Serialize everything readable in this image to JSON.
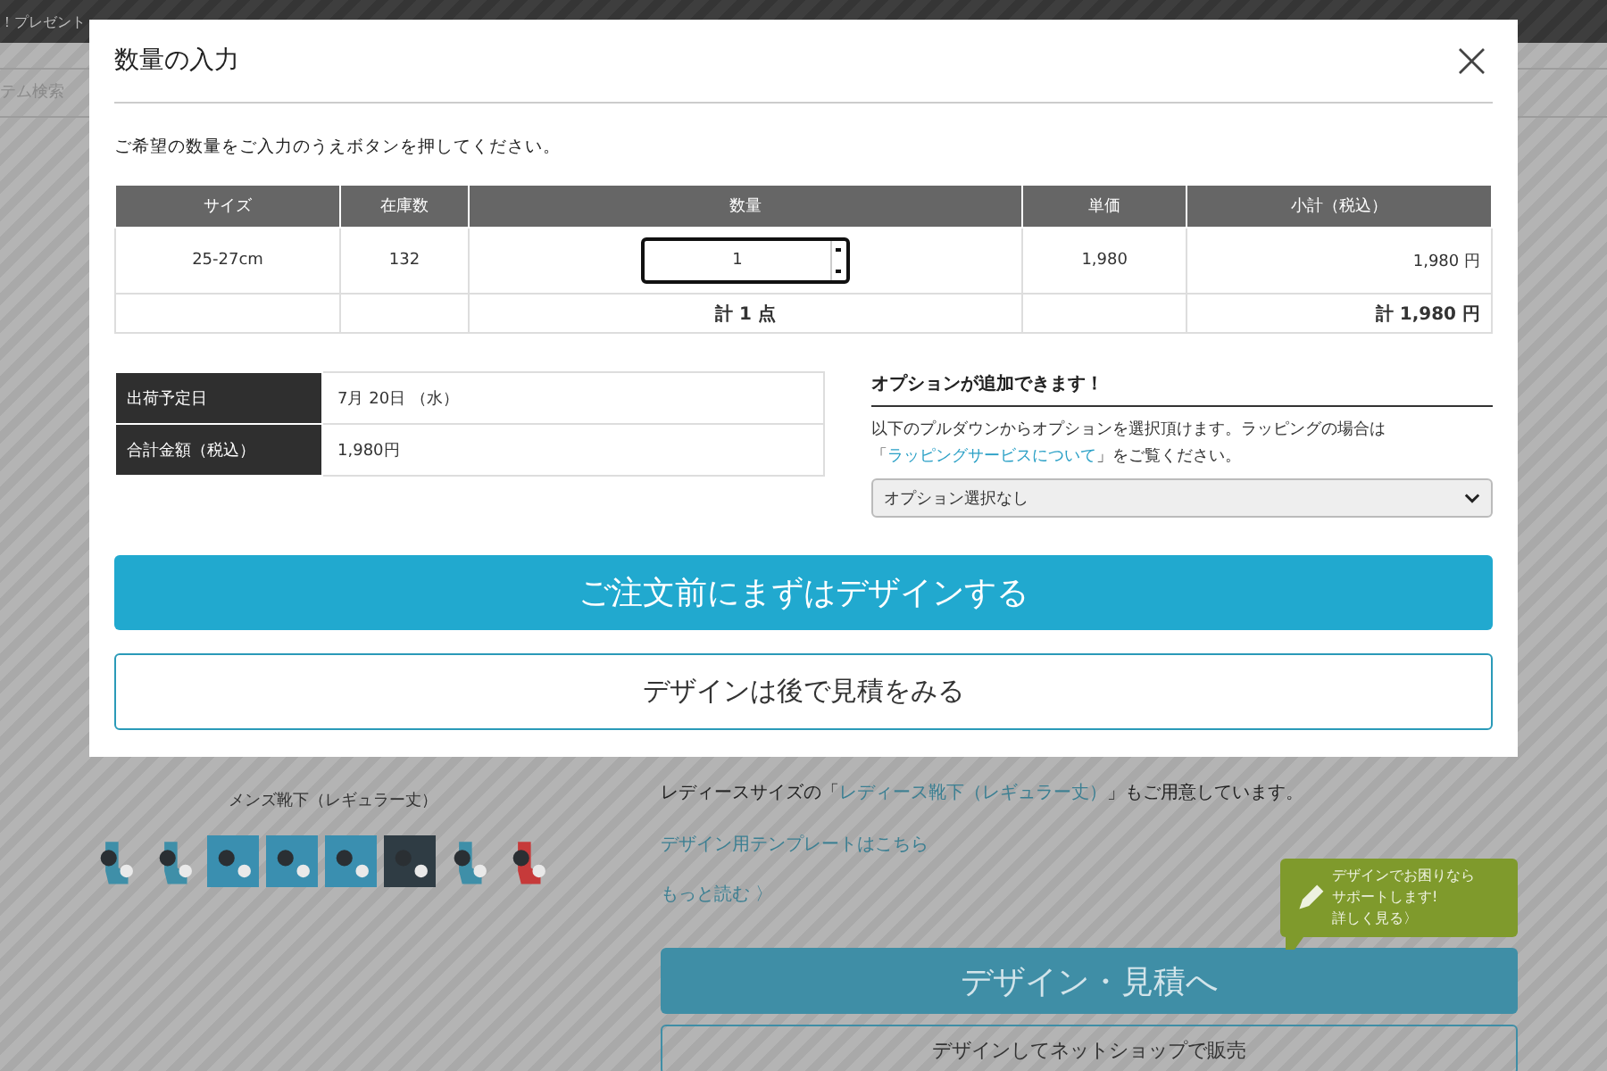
{
  "page": {
    "banner": "！プレゼント",
    "nav_item": "テム検索",
    "product_caption": "メンズ靴下（レギュラー丈）",
    "ladies_note": {
      "before": "レディースサイズの「",
      "link": "レディース靴下（レギュラー丈）",
      "after": "」もご用意しています。"
    },
    "template_link": "デザイン用テンプレートはこちら",
    "more_link": "もっと読む",
    "more_icon": "〉",
    "support_bubble": [
      "デザインでお困りなら",
      "サポートします!",
      "詳しく見る〉"
    ],
    "design_button": "デザイン・見積へ",
    "shop_button": "デザインしてネットショップで販売"
  },
  "dialog": {
    "title": "数量の入力",
    "close": "×",
    "instruction": "ご希望の数量をご入力のうえボタンを押してください。",
    "table": {
      "columns": [
        "サイズ",
        "在庫数",
        "数量",
        "単価",
        "小計（税込）"
      ],
      "rows": [
        {
          "size": "25-27cm",
          "stock": "132",
          "quantity": "1",
          "unit_price": "1,980",
          "subtotal": "1,980 円"
        }
      ],
      "total": {
        "quantity": "計 1 点",
        "amount": "計 1,980 円"
      }
    },
    "info": [
      {
        "label": "出荷予定日",
        "value": "7月 20日 （水）"
      },
      {
        "label": "合計金額（税込）",
        "value": "1,980円"
      }
    ],
    "options": {
      "heading": "オプションが追加できます！",
      "note_before": "以下のプルダウンからオプションを選択頂けます。ラッピングの場合は「",
      "note_link": "ラッピングサービスについて",
      "note_after": "」をご覧ください。",
      "select_value": "オプション選択なし"
    },
    "primary_button": "ご注文前にまずはデザインする",
    "secondary_button": "デザインは後で見積をみる"
  }
}
